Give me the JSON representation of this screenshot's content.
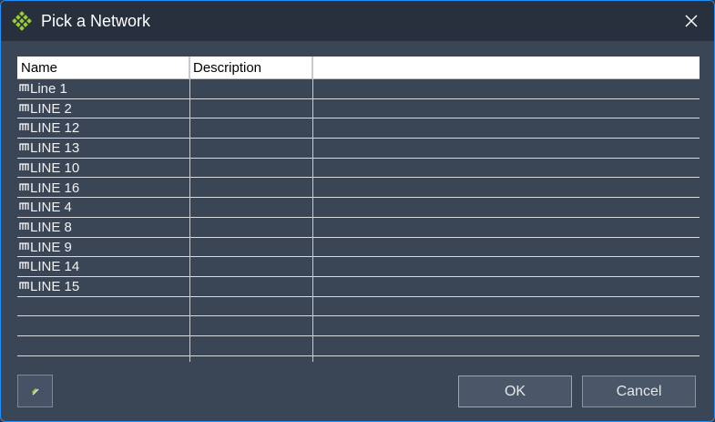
{
  "window": {
    "title": "Pick a Network"
  },
  "grid": {
    "columns": [
      "Name",
      "Description",
      ""
    ],
    "rows": [
      {
        "name": "Line 1",
        "description": ""
      },
      {
        "name": "LINE 2",
        "description": ""
      },
      {
        "name": "LINE 12",
        "description": ""
      },
      {
        "name": "LINE 13",
        "description": ""
      },
      {
        "name": "LINE 10",
        "description": ""
      },
      {
        "name": "LINE 16",
        "description": ""
      },
      {
        "name": "LINE 4",
        "description": ""
      },
      {
        "name": "LINE 8",
        "description": ""
      },
      {
        "name": "LINE 9",
        "description": ""
      },
      {
        "name": "LINE 14",
        "description": ""
      },
      {
        "name": "LINE 15",
        "description": ""
      }
    ],
    "empty_rows": 3
  },
  "buttons": {
    "ok": "OK",
    "cancel": "Cancel"
  },
  "icons": {
    "app": "diamond-grid-icon",
    "row": "network-icon",
    "tool": "tool-icon",
    "close": "close-icon"
  },
  "colors": {
    "accent": "#1e90ff",
    "title_bg": "#28303e",
    "body_bg": "#3a4556",
    "icon_green": "#9acd32"
  }
}
